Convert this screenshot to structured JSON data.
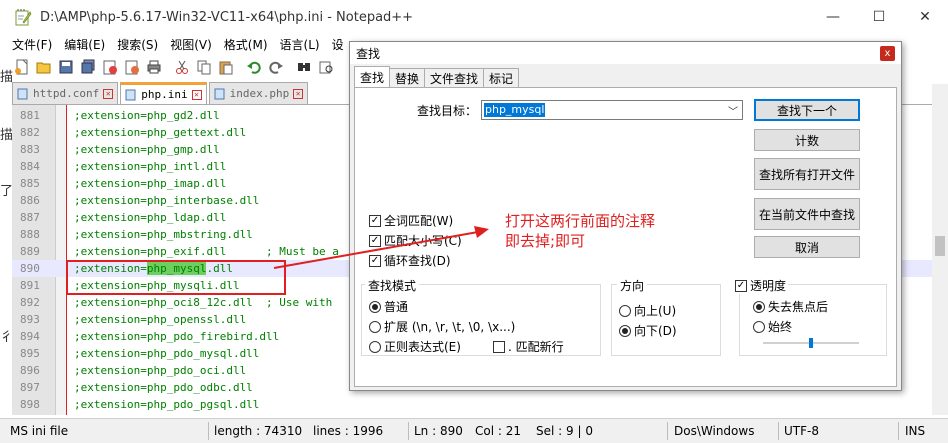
{
  "window": {
    "title": "D:\\AMP\\php-5.6.17-Win32-VC11-x64\\php.ini - Notepad++",
    "minimize": "—",
    "maximize": "☐",
    "close": "✕"
  },
  "menu": [
    "文件(F)",
    "编辑(E)",
    "搜索(S)",
    "视图(V)",
    "格式(M)",
    "语言(L)",
    "设"
  ],
  "tabs": [
    {
      "label": "httpd.conf",
      "active": false
    },
    {
      "label": "php.ini",
      "active": true
    },
    {
      "label": "index.php",
      "active": false
    }
  ],
  "editor": {
    "lines": [
      {
        "num": "881",
        "code": ";extension=php_gd2.dll"
      },
      {
        "num": "882",
        "code": ";extension=php_gettext.dll"
      },
      {
        "num": "883",
        "code": ";extension=php_gmp.dll"
      },
      {
        "num": "884",
        "code": ";extension=php_intl.dll"
      },
      {
        "num": "885",
        "code": ";extension=php_imap.dll"
      },
      {
        "num": "886",
        "code": ";extension=php_interbase.dll"
      },
      {
        "num": "887",
        "code": ";extension=php_ldap.dll"
      },
      {
        "num": "888",
        "code": ";extension=php_mbstring.dll"
      },
      {
        "num": "889",
        "code": ";extension=php_exif.dll      ; Must be a"
      },
      {
        "num": "890",
        "code_pre": ";extension=",
        "code_hl": "php_mysql",
        "code_post": ".dll"
      },
      {
        "num": "891",
        "code": ";extension=php_mysqli.dll"
      },
      {
        "num": "892",
        "code": ";extension=php_oci8_12c.dll  ; Use with"
      },
      {
        "num": "893",
        "code": ";extension=php_openssl.dll"
      },
      {
        "num": "894",
        "code": ";extension=php_pdo_firebird.dll"
      },
      {
        "num": "895",
        "code": ";extension=php_pdo_mysql.dll"
      },
      {
        "num": "896",
        "code": ";extension=php_pdo_oci.dll"
      },
      {
        "num": "897",
        "code": ";extension=php_pdo_odbc.dll"
      },
      {
        "num": "898",
        "code": ";extension=php_pdo_pgsql.dll"
      }
    ]
  },
  "statusbar": {
    "filetype": "MS ini file",
    "length": "length : 74310",
    "lines": "lines : 1996",
    "ln": "Ln : 890",
    "col": "Col : 21",
    "sel": "Sel : 9 | 0",
    "eol": "Dos\\Windows",
    "encoding": "UTF-8",
    "mode": "INS"
  },
  "dialog": {
    "title": "查找",
    "close": "x",
    "tabs": [
      "查找",
      "替换",
      "文件查找",
      "标记"
    ],
    "find_label": "查找目标：",
    "find_value": "php_mysql",
    "buttons": {
      "find_next": "查找下一个",
      "count": "计数",
      "find_all_open": "查找所有打开文件",
      "find_all_current": "在当前文件中查找",
      "cancel": "取消"
    },
    "options": {
      "whole_word": "全词匹配(W)",
      "match_case": "匹配大小写(C)",
      "wrap": "循环查找(D)"
    },
    "search_mode": {
      "label": "查找模式",
      "normal": "普通",
      "extended": "扩展 (\\n, \\r, \\t, \\0, \\x...)",
      "regex": "正则表达式(E)",
      "dot_newline": ". 匹配新行"
    },
    "direction": {
      "label": "方向",
      "up": "向上(U)",
      "down": "向下(D)"
    },
    "transparency": {
      "label": "透明度",
      "on_lose_focus": "失去焦点后",
      "always": "始终"
    }
  },
  "annotation": {
    "line1": "打开这两行前面的注释",
    "line2": "即去掉;即可"
  },
  "colors": {
    "comment": "#008000",
    "highlight": "#6ccf5f",
    "annotation_red": "#e02020",
    "accent": "#0078d7"
  },
  "page_edge": [
    "描",
    "了",
    "彳"
  ]
}
